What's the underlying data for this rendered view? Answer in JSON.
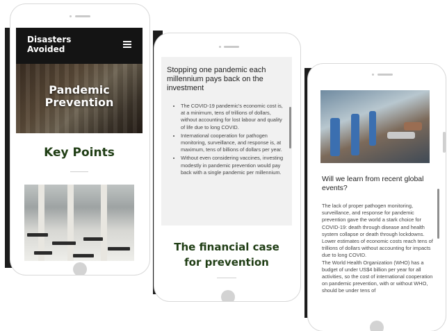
{
  "phone1": {
    "logo": "Disasters\nAvoided",
    "hero_title": "Pandemic\nPrevention",
    "heading": "Key Points"
  },
  "phone2": {
    "section_title": "Stopping one pandemic each millennium pays back on the investment",
    "bullets": [
      "The COVID-19 pandemic's economic cost is, at a minimum, tens of trillions of dollars, without accounting for lost labour and quality of life due to long COVID.",
      "International cooperation for pathogen monitoring, surveillance, and response is, at maximum, tens of billions of dollars per year.",
      "Without even considering vaccines, investing modestly in pandemic prevention would pay back with a single pandemic per millennium."
    ],
    "heading": "The financial case\nfor prevention"
  },
  "phone3": {
    "title": "Will we learn from recent global events?",
    "paragraphs": [
      "The lack of proper pathogen monitoring, surveillance, and response for pandemic prevention gave the world a stark choice for COVID-19: death through disease and health system collapse or death through lockdowns.",
      "Lower estimates of economic costs reach tens of trillions of dollars without accounting for impacts due to long COVID.",
      "The World Health Organization (WHO) has a budget of under US$4 billion per year for all activities, so the cost of international cooperation on pandemic prevention, with or without WHO, should be under tens of"
    ]
  }
}
